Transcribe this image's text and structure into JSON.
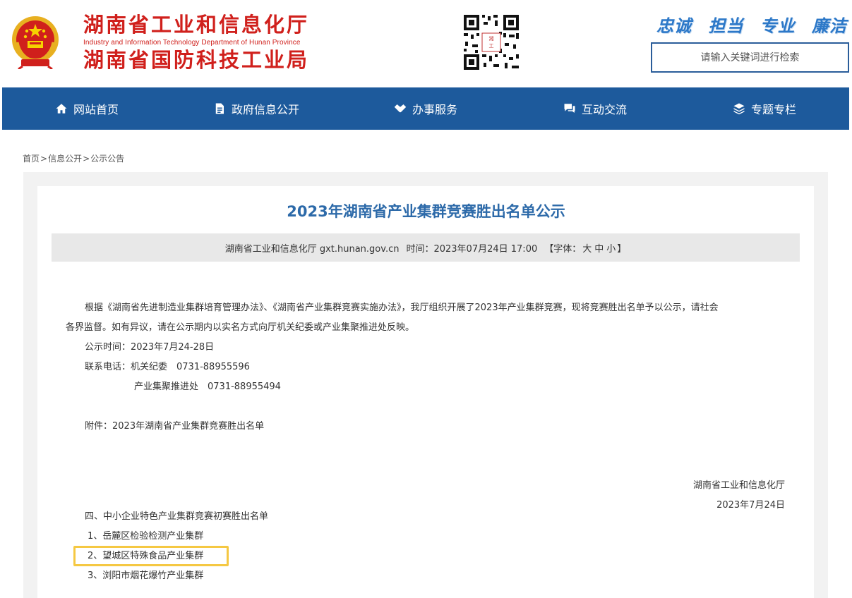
{
  "header": {
    "title_main": "湖南省工业和信息化厅",
    "title_en": "Industry and Information Technology Department of Hunan Province",
    "title_sub": "湖南省国防科技工业局",
    "emblem_icon": "national-emblem-icon",
    "qr_icon": "qr-code-icon",
    "slogans": [
      "忠诚",
      "担当",
      "专业",
      "廉洁"
    ],
    "search_placeholder": "请输入关键词进行检索"
  },
  "nav": {
    "items": [
      {
        "label": "网站首页",
        "icon": "home-icon"
      },
      {
        "label": "政府信息公开",
        "icon": "document-icon"
      },
      {
        "label": "办事服务",
        "icon": "handshake-icon"
      },
      {
        "label": "互动交流",
        "icon": "chat-icon"
      },
      {
        "label": "专题专栏",
        "icon": "layers-icon"
      }
    ]
  },
  "breadcrumb": {
    "items": [
      "首页",
      "信息公开",
      "公示公告"
    ],
    "separator": ">"
  },
  "article": {
    "title": "2023年湖南省产业集群竞赛胜出名单公示",
    "meta": {
      "source": "湖南省工业和信息化厅 gxt.hunan.gov.cn",
      "time": "时间：2023年07月24日 17:00",
      "font_label": "【字体：",
      "font_large": "大",
      "font_medium": "中",
      "font_small": "小",
      "font_end": "】"
    },
    "para1_line1": "根据《湖南省先进制造业集群培育管理办法》、《湖南省产业集群竞赛实施办法》，我厅组织开展了2023年产业集群竞赛，现将竞赛胜出名单予以公示，请社会",
    "para1_line2": "各界监督。如有异议，请在公示期内以实名方式向厅机关纪委或产业集聚推进处反映。",
    "period": "公示时间：2023年7月24-28日",
    "contact1": "联系电话：机关纪委　0731-88955596",
    "contact2": "产业集聚推进处　0731-88955494",
    "attachment": "附件：2023年湖南省产业集群竞赛胜出名单",
    "signature_org": "湖南省工业和信息化厅",
    "signature_date": "2023年7月24日",
    "section_title": "四、中小企业特色产业集群竞赛初赛胜出名单",
    "list": [
      "1、岳麓区检验检测产业集群",
      "2、望城区特殊食品产业集群",
      "3、浏阳市烟花爆竹产业集群"
    ]
  },
  "colors": {
    "brand_red": "#d0201c",
    "nav_blue": "#1d5a9c",
    "title_blue": "#2d6aa9",
    "slogan_blue": "#2c78c8",
    "highlight": "#f5c842"
  }
}
